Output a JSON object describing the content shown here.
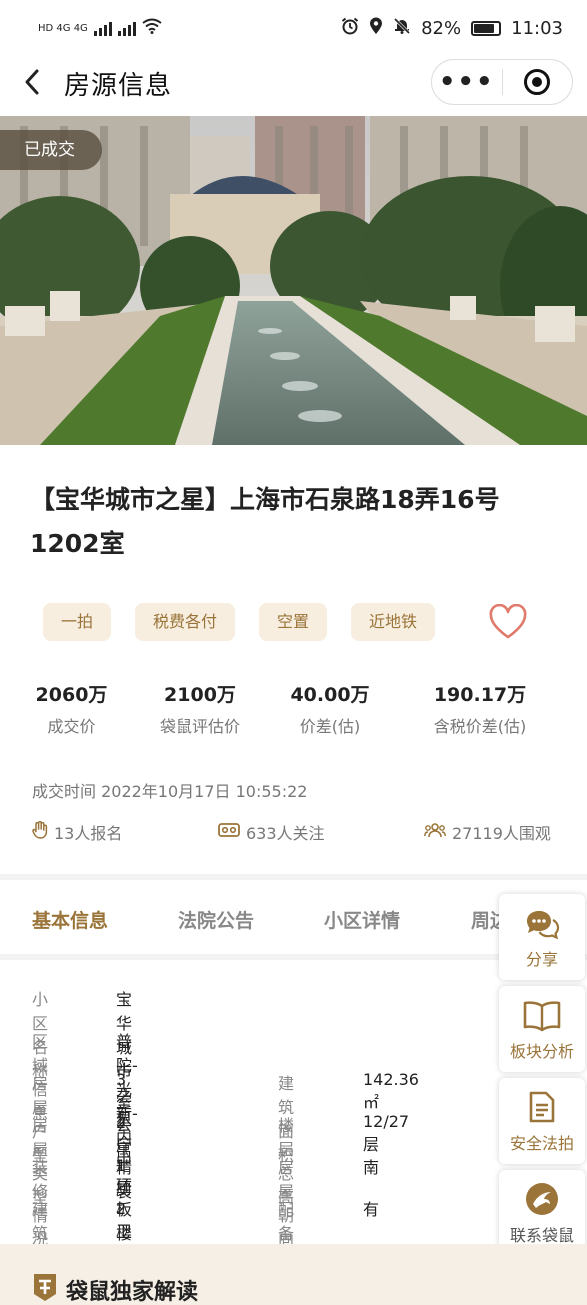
{
  "status_bar": {
    "left_label": "HD 4G 4G",
    "battery": "82%",
    "time": "11:03"
  },
  "nav": {
    "title": "房源信息",
    "more_label": "•••"
  },
  "hero": {
    "badge": "已成交"
  },
  "listing": {
    "title": "【宝华城市之星】上海市石泉路18弄16号1202室",
    "tags": [
      "一拍",
      "税费各付",
      "空置",
      "近地铁"
    ]
  },
  "stats": [
    {
      "value": "2060万",
      "label": "成交价"
    },
    {
      "value": "2100万",
      "label": "袋鼠评估价"
    },
    {
      "value": "40.00万",
      "label": "价差(估)"
    },
    {
      "value": "190.17万",
      "label": "含税价差(估)"
    }
  ],
  "deal_time": "成交时间 2022年10月17日 10:55:22",
  "social": {
    "signups": "13人报名",
    "followers": "633人关注",
    "viewers": "27119人围观"
  },
  "tabs": [
    "基本信息",
    "法院公告",
    "小区详情",
    "周边"
  ],
  "info": {
    "community_label": "小区名称",
    "community": "宝华城市之星",
    "area_label": "区域信息",
    "area": "普陀-光新-内中环",
    "layout_label": "房屋户型",
    "layout": "3室2厅1厨2卫",
    "floor_area_label": "建筑面积",
    "floor_area": "142.36㎡",
    "house_type_label": "房屋类型",
    "house_type": "公寓",
    "floors_label": "楼层总高",
    "floors": "12/27层",
    "decoration_label": "装修情况",
    "decoration": "精装",
    "orientation_label": "房屋朝向",
    "orientation": "南",
    "building_type_label": "建筑类型",
    "building_type": "板楼",
    "elevator_label": "配备电梯",
    "elevator": "有"
  },
  "floating": {
    "share": "分享",
    "analysis": "板块分析",
    "safe_auction": "安全法拍",
    "contact": "联系袋鼠"
  },
  "exclusive_title": "袋鼠独家解读",
  "colors": {
    "accent": "#9a7439",
    "tag_bg": "#f7eee0",
    "heart": "#e07a6a"
  }
}
